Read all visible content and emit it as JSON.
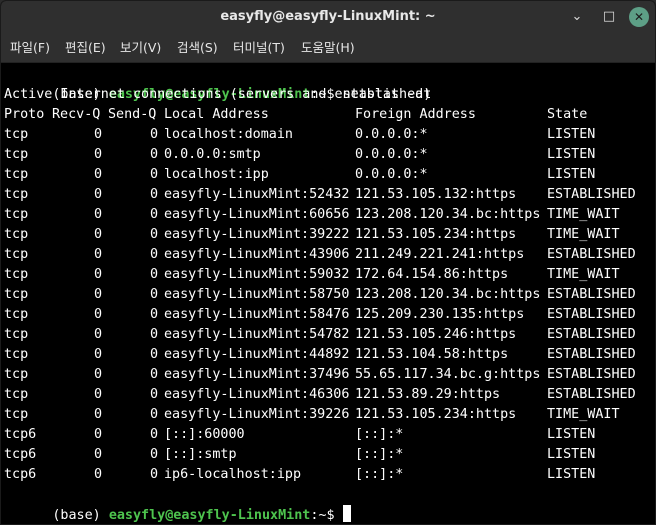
{
  "window": {
    "title": "easyfly@easyfly-LinuxMint: ~",
    "controls": {
      "minimize": "⌄",
      "maximize": "□",
      "close": "✕"
    }
  },
  "menu": [
    "파일(F)",
    "편집(E)",
    "보기(V)",
    "검색(S)",
    "터미널(T)",
    "도움말(H)"
  ],
  "terminal": {
    "prompt": {
      "env": "(base)",
      "user_host": "easyfly@easyfly-LinuxMint",
      "path": ":~$",
      "command": "netstat -at"
    },
    "heading": "Active Internet connections (servers and established)",
    "columns": [
      "Proto",
      "Recv-Q",
      "Send-Q",
      "Local Address",
      "Foreign Address",
      "State"
    ],
    "rows": [
      [
        "tcp",
        "0",
        "0",
        "localhost:domain",
        "0.0.0.0:*",
        "LISTEN"
      ],
      [
        "tcp",
        "0",
        "0",
        "0.0.0.0:smtp",
        "0.0.0.0:*",
        "LISTEN"
      ],
      [
        "tcp",
        "0",
        "0",
        "localhost:ipp",
        "0.0.0.0:*",
        "LISTEN"
      ],
      [
        "tcp",
        "0",
        "0",
        "easyfly-LinuxMint:52432",
        "121.53.105.132:https",
        "ESTABLISHED"
      ],
      [
        "tcp",
        "0",
        "0",
        "easyfly-LinuxMint:60656",
        "123.208.120.34.bc:https",
        "TIME_WAIT"
      ],
      [
        "tcp",
        "0",
        "0",
        "easyfly-LinuxMint:39222",
        "121.53.105.234:https",
        "TIME_WAIT"
      ],
      [
        "tcp",
        "0",
        "0",
        "easyfly-LinuxMint:43906",
        "211.249.221.241:https",
        "ESTABLISHED"
      ],
      [
        "tcp",
        "0",
        "0",
        "easyfly-LinuxMint:59032",
        "172.64.154.86:https",
        "TIME_WAIT"
      ],
      [
        "tcp",
        "0",
        "0",
        "easyfly-LinuxMint:58750",
        "123.208.120.34.bc:https",
        "ESTABLISHED"
      ],
      [
        "tcp",
        "0",
        "0",
        "easyfly-LinuxMint:58476",
        "125.209.230.135:https",
        "ESTABLISHED"
      ],
      [
        "tcp",
        "0",
        "0",
        "easyfly-LinuxMint:54782",
        "121.53.105.246:https",
        "ESTABLISHED"
      ],
      [
        "tcp",
        "0",
        "0",
        "easyfly-LinuxMint:44892",
        "121.53.104.58:https",
        "ESTABLISHED"
      ],
      [
        "tcp",
        "0",
        "0",
        "easyfly-LinuxMint:37496",
        "55.65.117.34.bc.g:https",
        "ESTABLISHED"
      ],
      [
        "tcp",
        "0",
        "0",
        "easyfly-LinuxMint:46306",
        "121.53.89.29:https",
        "ESTABLISHED"
      ],
      [
        "tcp",
        "0",
        "0",
        "easyfly-LinuxMint:39226",
        "121.53.105.234:https",
        "TIME_WAIT"
      ],
      [
        "tcp6",
        "0",
        "0",
        "[::]:60000",
        "[::]:*",
        "LISTEN"
      ],
      [
        "tcp6",
        "0",
        "0",
        "[::]:smtp",
        "[::]:*",
        "LISTEN"
      ],
      [
        "tcp6",
        "0",
        "0",
        "ip6-localhost:ipp",
        "[::]:*",
        "LISTEN"
      ]
    ]
  }
}
